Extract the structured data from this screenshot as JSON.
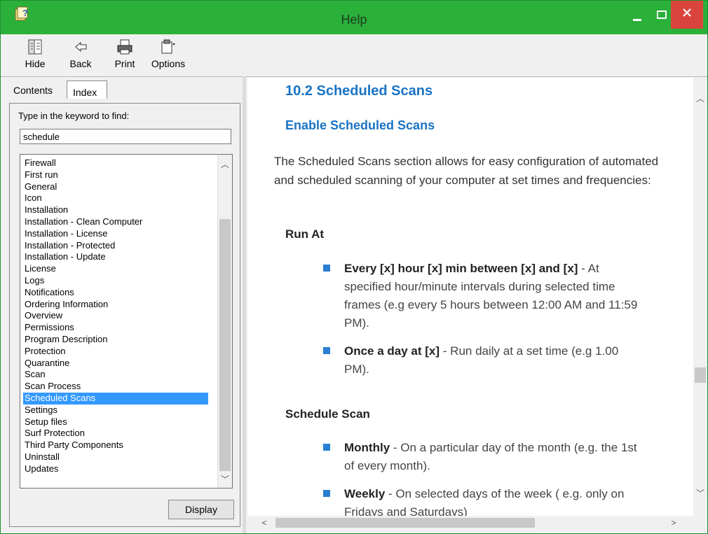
{
  "window": {
    "title": "Help",
    "app_icon": "help-question-icon"
  },
  "toolbar": {
    "hide_label": "Hide",
    "back_label": "Back",
    "print_label": "Print",
    "options_label": "Options"
  },
  "tabs": {
    "contents": "Contents",
    "index": "Index"
  },
  "index_pane": {
    "find_label": "Type in the keyword to find:",
    "search_value": "schedule",
    "display_button": "Display",
    "selected": "Scheduled Scans",
    "items": [
      "Firewall",
      "First run",
      "General",
      "Icon",
      "Installation",
      "Installation - Clean Computer",
      "Installation - License",
      "Installation - Protected",
      "Installation - Update",
      "License",
      "Logs",
      "Notifications",
      "Ordering Information",
      "Overview",
      "Permissions",
      "Program Description",
      "Protection",
      "Quarantine",
      "Scan",
      "Scan Process",
      "Scheduled Scans",
      "Settings",
      "Setup files",
      "Surf Protection",
      "Third Party Components",
      "Uninstall",
      "Updates"
    ]
  },
  "article": {
    "heading": "10.2 Scheduled Scans",
    "subheading": "Enable Scheduled Scans",
    "intro": "The Scheduled Scans section allows for easy configuration of automated and scheduled scanning of your computer at set times and frequencies:",
    "run_at_title": "Run At",
    "run_at_items": [
      {
        "bold": "Every [x] hour [x] min between [x] and [x]",
        "text": " - At specified hour/minute intervals during selected time frames (e.g every 5 hours between 12:00 AM and 11:59 PM)."
      },
      {
        "bold": "Once a day at [x]",
        "text": " - Run daily at a set time (e.g 1.00 PM)."
      }
    ],
    "schedule_title": "Schedule Scan",
    "schedule_items": [
      {
        "bold": "Monthly",
        "text": " - On a particular day of the month (e.g. the 1st of every month)."
      },
      {
        "bold": "Weekly",
        "text": " - On selected days of the week ( e.g. only on Fridays and Saturdays)"
      }
    ]
  },
  "colors": {
    "titlebar": "#2bb03a",
    "close": "#d9453c",
    "heading": "#1a73c4",
    "selection": "#3399ff"
  }
}
